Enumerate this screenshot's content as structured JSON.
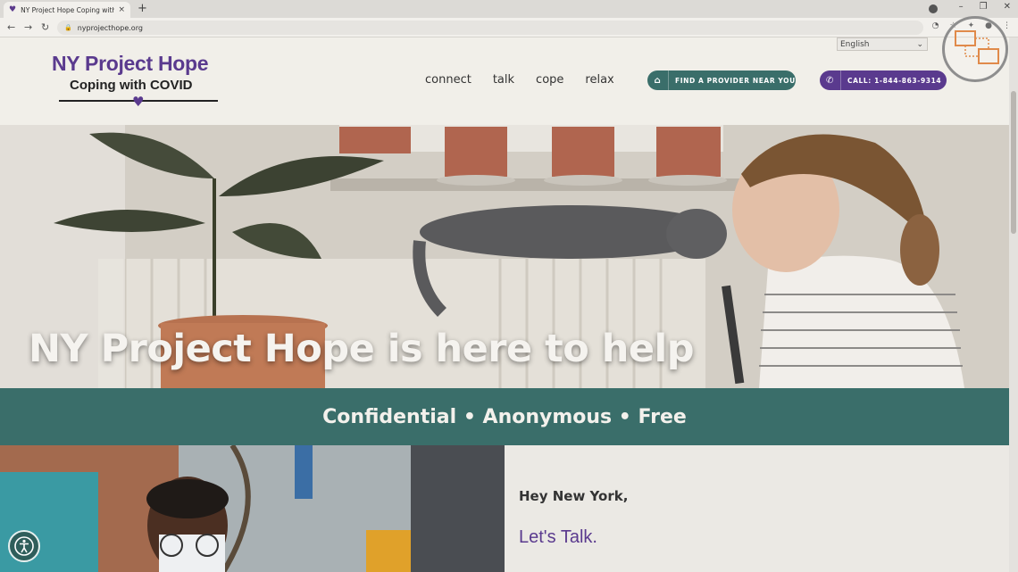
{
  "browser": {
    "tab_title": "NY Project Hope Coping with CO",
    "tab_close": "×",
    "new_tab": "+",
    "url": "nyprojecthope.org",
    "window_controls": [
      "–",
      "❐",
      "✕"
    ]
  },
  "header": {
    "logo_line1": "NY Project Hope",
    "logo_line2": "Coping with COVID",
    "language": "English",
    "nav": [
      {
        "label": "connect"
      },
      {
        "label": "talk"
      },
      {
        "label": "cope"
      },
      {
        "label": "relax"
      }
    ],
    "find_provider_label": "FIND A PROVIDER NEAR YOU",
    "call_label": "CALL: 1-844-863-9314"
  },
  "hero": {
    "headline": "NY Project Hope is here to help"
  },
  "band": {
    "text": "Confidential • Anonymous • Free"
  },
  "lower": {
    "greeting": "Hey New York,",
    "cta": "Let's Talk."
  },
  "colors": {
    "purple": "#5a3a8e",
    "teal": "#3a6e6a"
  },
  "icons": {
    "tab": "heart-icon",
    "find": "home-icon",
    "call": "phone-icon",
    "a11y": "accessibility-icon"
  }
}
